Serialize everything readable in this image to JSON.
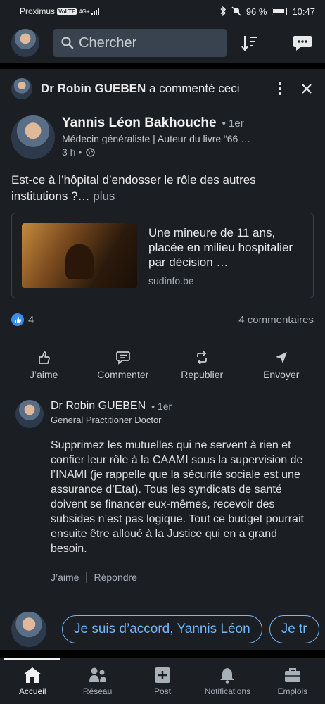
{
  "status_bar": {
    "carrier": "Proximus",
    "volte": "VoLTE",
    "network": "4G+",
    "battery": "96 %",
    "time": "10:47"
  },
  "header": {
    "search_placeholder": "Chercher"
  },
  "activity": {
    "actor": "Dr Robin GUEBEN",
    "action": "a commenté ceci"
  },
  "post": {
    "author_name": "Yannis Léon Bakhouche",
    "author_degree": "• 1er",
    "author_headline": "Médecin généraliste | Auteur du livre “66 …",
    "time": "3 h •",
    "text": "Est-ce à l’hôpital d’endosser le rôle des autres institutions ?…",
    "more_label": "plus",
    "article_title": "Une mineure de 11 ans, placée en milieu hospitalier par décision …",
    "article_source": "sudinfo.be",
    "reactions_count": "4",
    "comments_count": "4 commentaires"
  },
  "actions": {
    "like": "J’aime",
    "comment": "Commenter",
    "repost": "Republier",
    "send": "Envoyer"
  },
  "comment": {
    "name": "Dr Robin GUEBEN",
    "degree": "• 1er",
    "headline": "General Practitioner Doctor",
    "text": "Supprimez les mutuelles qui ne servent à rien et confier leur rôle à la CAAMI sous la supervision de l’INAMI (je rappelle que la sécurité sociale est une assurance d’Etat). Tous les syndicats de santé doivent se financer eux-mêmes, recevoir des subsides n’est pas logique. Tout ce budget pourrait ensuite être alloué à la Justice qui en a grand besoin.",
    "like_label": "J’aime",
    "reply_label": "Répondre"
  },
  "quick_replies": [
    "Je suis d’accord, Yannis Léon",
    "Je tr"
  ],
  "bottom_nav": {
    "home": "Accueil",
    "network": "Réseau",
    "post": "Post",
    "notifications": "Notifications",
    "jobs": "Emplois"
  },
  "colors": {
    "background": "#1b1f23",
    "accent": "#71b7fb",
    "like_badge": "#378fe9"
  }
}
